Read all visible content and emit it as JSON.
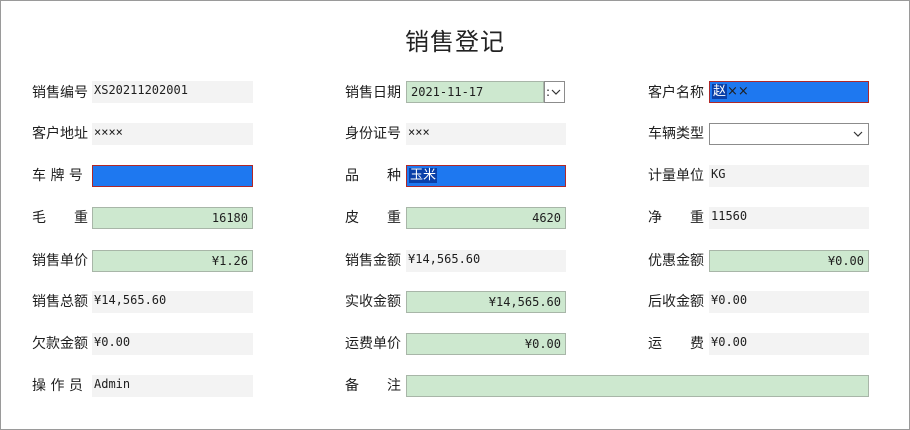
{
  "title": "销售登记",
  "fields": {
    "sales_no": {
      "label": "销售编号",
      "value": "XS20211202001"
    },
    "sales_date": {
      "label": "销售日期",
      "value": "2021-11-17",
      "spin_glyph": ":"
    },
    "customer_name": {
      "label": "客户名称",
      "selected": "赵",
      "rest": "××"
    },
    "customer_address": {
      "label": "客户地址",
      "value": "××××"
    },
    "id_number": {
      "label": "身份证号",
      "value": "×××"
    },
    "vehicle_type": {
      "label": "车辆类型",
      "value": ""
    },
    "plate_no": {
      "label": "车 牌 号",
      "value": ""
    },
    "variety": {
      "label": "品　　种",
      "value": "玉米"
    },
    "unit": {
      "label": "计量单位",
      "value": "KG"
    },
    "gross_weight": {
      "label": "毛　　重",
      "value": "16180"
    },
    "tare_weight": {
      "label": "皮　　重",
      "value": "4620"
    },
    "net_weight": {
      "label": "净　　重",
      "value": "11560"
    },
    "unit_price": {
      "label": "销售单价",
      "value": "¥1.26"
    },
    "sales_amount": {
      "label": "销售金额",
      "value": "¥14,565.60"
    },
    "discount": {
      "label": "优惠金额",
      "value": "¥0.00"
    },
    "total_amount": {
      "label": "销售总额",
      "value": "¥14,565.60"
    },
    "received": {
      "label": "实收金额",
      "value": "¥14,565.60"
    },
    "post_received": {
      "label": "后收金额",
      "value": "¥0.00"
    },
    "debt": {
      "label": "欠款金额",
      "value": "¥0.00"
    },
    "freight_price": {
      "label": "运费单价",
      "value": "¥0.00"
    },
    "freight": {
      "label": "运　　费",
      "value": "¥0.00"
    },
    "operator": {
      "label": "操 作 员",
      "value": "Admin"
    },
    "remark": {
      "label": "备　　注",
      "value": ""
    }
  },
  "colors": {
    "input_green": "#cde8cf",
    "selection_blue": "#1e78f0",
    "focus_red": "#b02828",
    "readonly_gray": "#f3f3f3"
  }
}
